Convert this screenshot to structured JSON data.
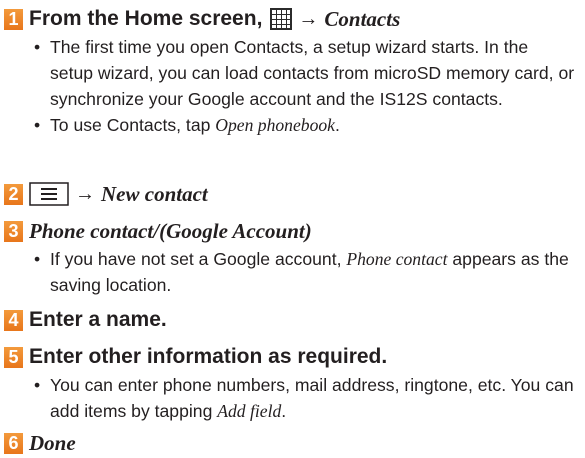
{
  "steps": [
    {
      "number": "1",
      "head_text": "From the Home screen,",
      "head_icon": "apps-grid-icon",
      "head_target": "Contacts",
      "bullets": [
        {
          "text": "The first time you open Contacts, a setup wizard starts. In the setup wizard, you can load contacts from microSD memory card, or synchronize your Google account and the IS12S contacts."
        },
        {
          "pre": "To use Contacts, tap ",
          "italic": "Open phonebook",
          "post": "."
        }
      ]
    },
    {
      "number": "2",
      "head_icon": "menu-key-icon",
      "head_target": "New contact"
    },
    {
      "number": "3",
      "head_text": "Phone contact/(Google Account)",
      "bullets": [
        {
          "pre": "If you have not set a Google account, ",
          "italic": "Phone contact",
          "post": " appears as the saving location."
        }
      ]
    },
    {
      "number": "4",
      "head_text": "Enter a name."
    },
    {
      "number": "5",
      "head_text": "Enter other information as required.",
      "bullets": [
        {
          "pre": "You can enter phone numbers, mail address, ringtone, etc. You can add items by tapping ",
          "italic": "Add field",
          "post": "."
        }
      ]
    },
    {
      "number": "6",
      "head_text": "Done"
    }
  ],
  "arrow": "→",
  "colors": {
    "step_badge": "#e8761b",
    "text": "#231f20"
  }
}
